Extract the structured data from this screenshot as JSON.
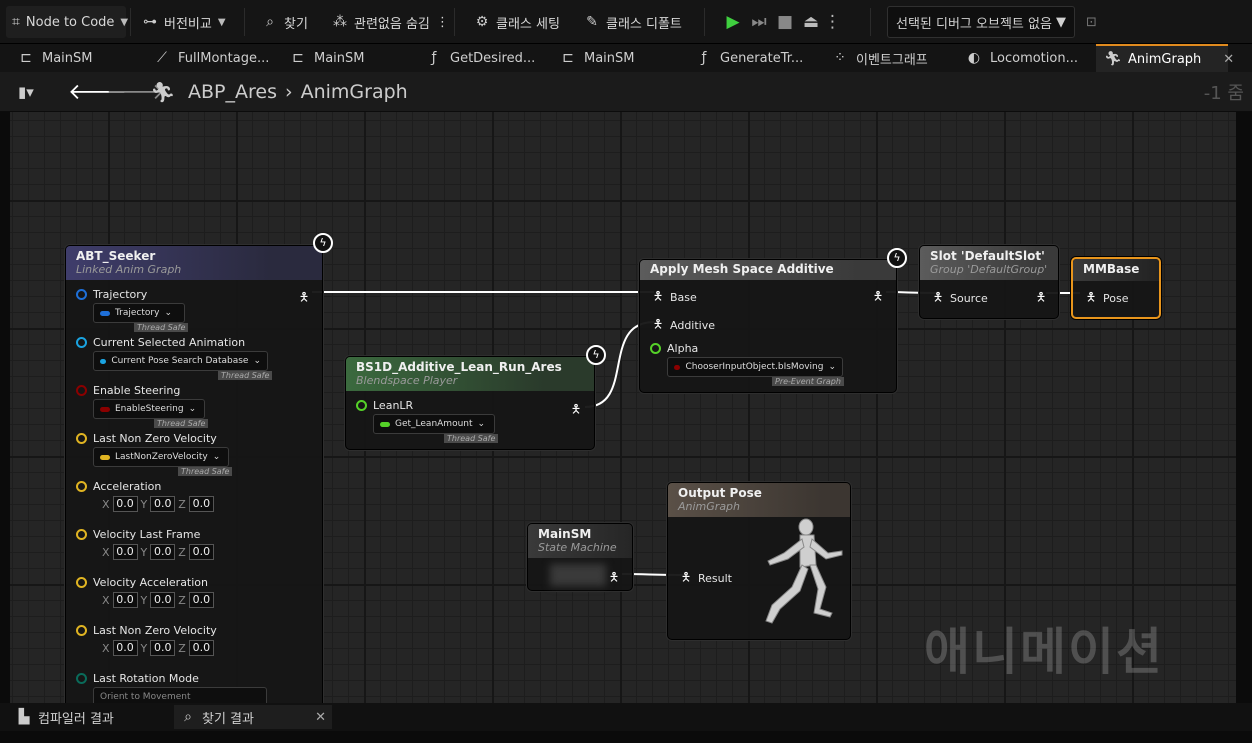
{
  "toolbar": {
    "node_to_code": "Node to Code",
    "version_compare": "버전비교",
    "find": "찾기",
    "hide_unrelated": "관련없음 숨김",
    "class_settings": "클래스 세팅",
    "class_defaults": "클래스 디폴트",
    "debug_object": "선택된 디버그 오브젝트 없음"
  },
  "tabs": [
    "MainSM",
    "FullMontage...",
    "MainSM",
    "GetDesired...",
    "MainSM",
    "GenerateTr...",
    "이벤트그래프",
    "Locomotion...",
    "AnimGraph"
  ],
  "breadcrumb": {
    "asset": "ABP_Ares",
    "graph": "AnimGraph",
    "zoom": "-1 줌"
  },
  "nodes": {
    "seeker": {
      "title": "ABT_Seeker",
      "subtitle": "Linked Anim Graph",
      "pins": [
        {
          "label": "Trajectory",
          "value": "Trajectory",
          "tag": "Thread Safe"
        },
        {
          "label": "Current Selected Animation",
          "value": "Current Pose Search Database",
          "tag": "Thread Safe"
        },
        {
          "label": "Enable Steering",
          "value": "EnableSteering",
          "tag": "Thread Safe"
        },
        {
          "label": "Last Non Zero Velocity",
          "value": "LastNonZeroVelocity",
          "tag": "Thread Safe"
        },
        {
          "label": "Acceleration",
          "x": "0.0",
          "y": "0.0",
          "z": "0.0"
        },
        {
          "label": "Velocity Last Frame",
          "x": "0.0",
          "y": "0.0",
          "z": "0.0"
        },
        {
          "label": "Velocity Acceleration",
          "x": "0.0",
          "y": "0.0",
          "z": "0.0"
        },
        {
          "label": "Last Non Zero Velocity",
          "x": "0.0",
          "y": "0.0",
          "z": "0.0"
        },
        {
          "label": "Last Rotation Mode",
          "value": "Orient to Movement"
        }
      ],
      "axis_x": "X",
      "axis_y": "Y",
      "axis_z": "Z"
    },
    "blendspace": {
      "title": "BS1D_Additive_Lean_Run_Ares",
      "subtitle": "Blendspace Player",
      "pin_label": "LeanLR",
      "pin_value": "Get_LeanAmount",
      "pin_tag": "Thread Safe"
    },
    "additive": {
      "title": "Apply Mesh Space Additive",
      "base": "Base",
      "additive": "Additive",
      "alpha": "Alpha",
      "alpha_value": "ChooserInputObject.bIsMoving",
      "alpha_tag": "Pre-Event Graph"
    },
    "slot": {
      "title": "Slot 'DefaultSlot'",
      "subtitle": "Group 'DefaultGroup'",
      "source": "Source"
    },
    "mmbase": {
      "title": "MMBase",
      "pose": "Pose"
    },
    "mainsm": {
      "title": "MainSM",
      "subtitle": "State Machine"
    },
    "output": {
      "title": "Output Pose",
      "subtitle": "AnimGraph",
      "result": "Result"
    }
  },
  "watermark": "애니메이션",
  "bottom": {
    "compiler_results": "컴파일러 결과",
    "find_results": "찾기 결과"
  },
  "colors": {
    "seeker_header": "#3f3d6b",
    "blendspace_header": "#3b6a3e",
    "additive_header": "#5c5c5c",
    "output_header": "#5a5047",
    "mmbase_border": "#e8951c",
    "wire": "#ffffff",
    "pin_struct_blue": "#1e6fd8",
    "pin_object_cyan": "#1aa3e0",
    "pin_bool_red": "#8b0000",
    "pin_vector_yellow": "#e0b422",
    "pin_float_green": "#55d128",
    "pin_enum_teal": "#0a6b5a"
  }
}
